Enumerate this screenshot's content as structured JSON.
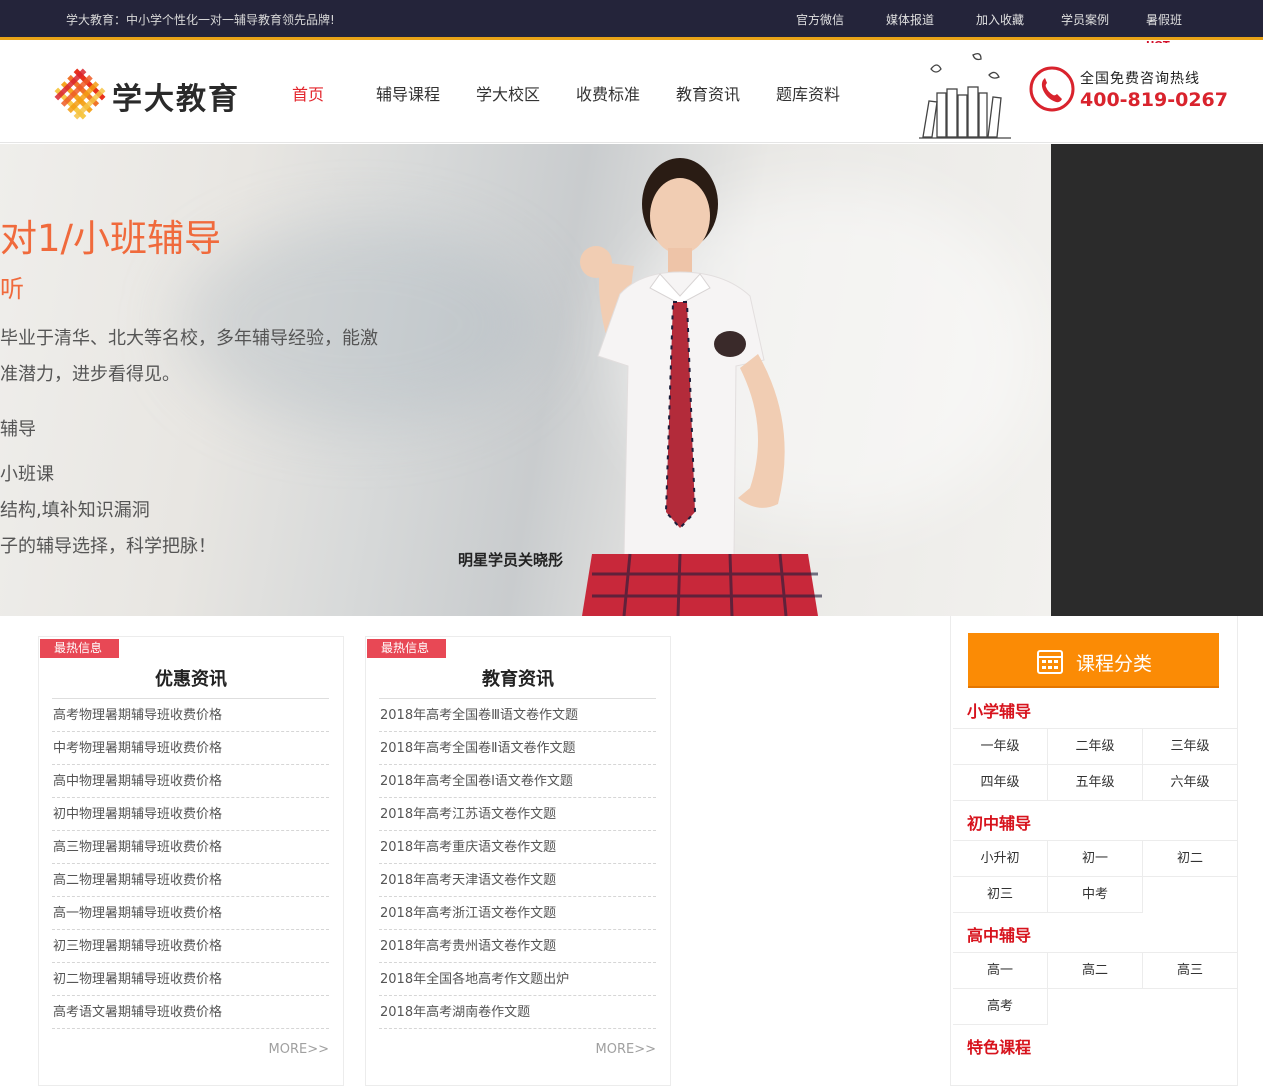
{
  "topbar": {
    "slogan": "学大教育：中小学个性化一对一辅导教育领先品牌!",
    "links": [
      "官方微信",
      "媒体报道",
      "加入收藏",
      "学员案例",
      "暑假班"
    ],
    "hot_badge": "HOT"
  },
  "header": {
    "logo_text": "学大教育",
    "nav": [
      "首页",
      "辅导课程",
      "学大校区",
      "收费标准",
      "教育资讯",
      "题库资料"
    ],
    "active_nav_index": 0,
    "hotline_label": "全国免费咨询热线",
    "hotline_number": "400-819-0267"
  },
  "banner": {
    "title": "对1/小班辅导",
    "subtitle": "听",
    "lines": [
      "毕业于清华、北大等名校，多年辅导经验，能激",
      "准潜力，进步看得见。",
      "辅导",
      "小班课",
      "结构,填补知识漏洞",
      "子的辅导选择，科学把脉！"
    ],
    "student_caption": "明星学员关晓彤"
  },
  "news_left": {
    "tag": "最热信息",
    "title": "优惠资讯",
    "items": [
      "高考物理暑期辅导班收费价格",
      "中考物理暑期辅导班收费价格",
      "高中物理暑期辅导班收费价格",
      "初中物理暑期辅导班收费价格",
      "高三物理暑期辅导班收费价格",
      "高二物理暑期辅导班收费价格",
      "高一物理暑期辅导班收费价格",
      "初三物理暑期辅导班收费价格",
      "初二物理暑期辅导班收费价格",
      "高考语文暑期辅导班收费价格"
    ],
    "more": "MORE>>"
  },
  "news_right": {
    "tag": "最热信息",
    "title": "教育资讯",
    "items": [
      "2018年高考全国卷Ⅲ语文卷作文题",
      "2018年高考全国卷Ⅱ语文卷作文题",
      "2018年高考全国卷Ⅰ语文卷作文题",
      "2018年高考江苏语文卷作文题",
      "2018年高考重庆语文卷作文题",
      "2018年高考天津语文卷作文题",
      "2018年高考浙江语文卷作文题",
      "2018年高考贵州语文卷作文题",
      "2018年全国各地高考作文题出炉",
      "2018年高考湖南卷作文题"
    ],
    "more": "MORE>>"
  },
  "sidebar": {
    "button_label": "课程分类",
    "sections": [
      {
        "title": "小学辅导",
        "items": [
          "一年级",
          "二年级",
          "三年级",
          "四年级",
          "五年级",
          "六年级"
        ]
      },
      {
        "title": "初中辅导",
        "items": [
          "小升初",
          "初一",
          "初二",
          "初三",
          "中考"
        ]
      },
      {
        "title": "高中辅导",
        "items": [
          "高一",
          "高二",
          "高三",
          "高考"
        ]
      },
      {
        "title": "特色课程",
        "items": []
      }
    ]
  },
  "colors": {
    "accent_red": "#e3262d",
    "orange": "#fb8b05",
    "topbar_bg": "#24243a",
    "gold_rule": "#e8a317"
  }
}
